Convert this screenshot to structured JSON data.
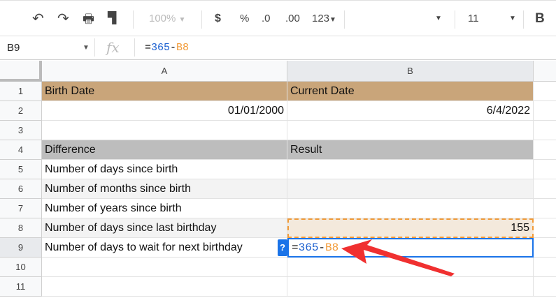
{
  "toolbar": {
    "zoom": "100%",
    "currency": "$",
    "percent": "%",
    "dec_decrease": ".0",
    "dec_increase": ".00",
    "format": "123",
    "font_size": "11",
    "bold": "B"
  },
  "formula_bar": {
    "name_box": "B9",
    "fx": "fx",
    "formula_eq": "=",
    "formula_num": "365",
    "formula_op": "-",
    "formula_ref": "B8"
  },
  "columns": [
    "A",
    "B"
  ],
  "rows": [
    "1",
    "2",
    "3",
    "4",
    "5",
    "6",
    "7",
    "8",
    "9",
    "10",
    "11"
  ],
  "cells": {
    "A1": "Birth Date",
    "B1": "Current Date",
    "A2": "01/01/2000",
    "B2": "6/4/2022",
    "A4": "Difference",
    "B4": "Result",
    "A5": "Number of days since birth",
    "A6": "Number of months since birth",
    "A7": "Number of years since birth",
    "A8": "Number of days since last birthday",
    "B8": "155",
    "A9": "Number of days to wait for next birthday"
  },
  "help_badge": "?",
  "colors": {
    "header_tan": "#c9a57a",
    "header_gray": "#bdbdbd",
    "ref_orange": "#f29b38",
    "num_blue": "#1a5fd0",
    "select_blue": "#1a73e8",
    "arrow_red": "#f03030"
  }
}
